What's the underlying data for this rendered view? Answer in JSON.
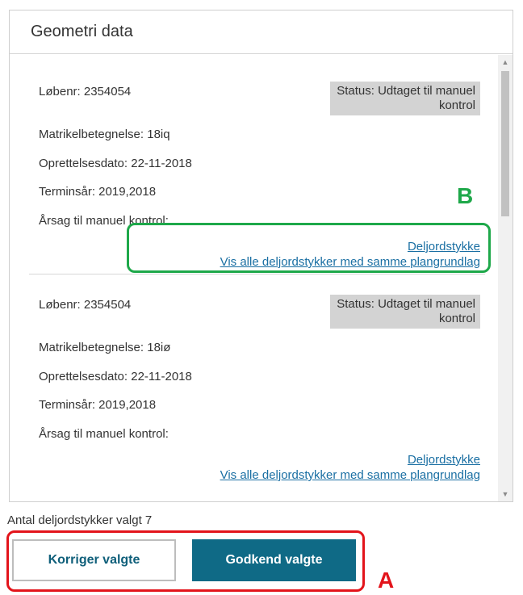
{
  "panel": {
    "title": "Geometri data"
  },
  "records": [
    {
      "lobenr": "Løbenr: 2354054",
      "status": "Status: Udtaget til manuel kontrol",
      "matrikel": "Matrikelbetegnelse: 18iq",
      "oprettelse": "Oprettelsesdato: 22-11-2018",
      "terminsaar": "Terminsår: 2019,2018",
      "aarsag": "Årsag til manuel kontrol:",
      "link_deljord": "Deljordstykke",
      "link_vis_alle": "Vis alle deljordstykker med samme plangrundlag"
    },
    {
      "lobenr": "Løbenr: 2354504",
      "status": "Status: Udtaget til manuel kontrol",
      "matrikel": "Matrikelbetegnelse: 18iø",
      "oprettelse": "Oprettelsesdato: 22-11-2018",
      "terminsaar": "Terminsår: 2019,2018",
      "aarsag": "Årsag til manuel kontrol:",
      "link_deljord": "Deljordstykke",
      "link_vis_alle": "Vis alle deljordstykker med samme plangrundlag"
    }
  ],
  "footer": {
    "count_text": "Antal deljordstykker valgt 7",
    "korriger_label": "Korriger valgte",
    "godkend_label": "Godkend valgte"
  },
  "annotations": {
    "a": "A",
    "b": "B"
  },
  "colors": {
    "primary_button": "#0f6a86",
    "link": "#1a6fa3",
    "status_bg": "#d3d3d3",
    "annotation_a": "#e3141b",
    "annotation_b": "#1ea84a"
  }
}
